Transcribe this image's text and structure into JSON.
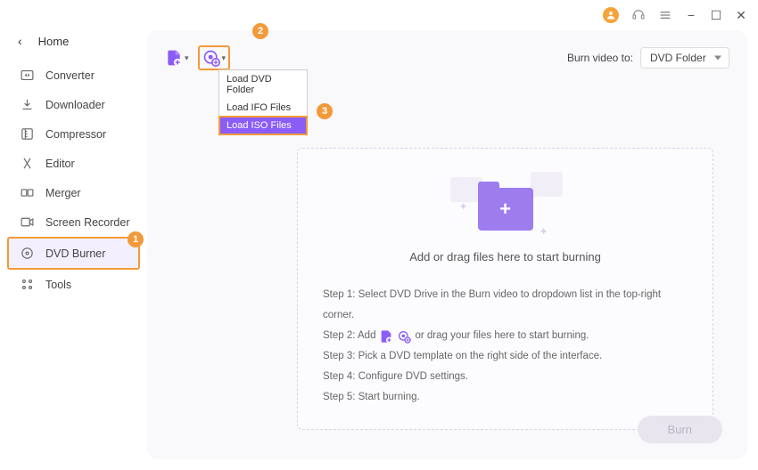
{
  "titlebar": {
    "avatar": "user-avatar",
    "support": "support-icon",
    "menu": "menu-icon",
    "minimize": "−",
    "maximize": "☐",
    "close": "✕"
  },
  "sidebar": {
    "back_label": "Home",
    "items": [
      {
        "icon": "converter-icon",
        "label": "Converter"
      },
      {
        "icon": "downloader-icon",
        "label": "Downloader"
      },
      {
        "icon": "compressor-icon",
        "label": "Compressor"
      },
      {
        "icon": "editor-icon",
        "label": "Editor"
      },
      {
        "icon": "merger-icon",
        "label": "Merger"
      },
      {
        "icon": "recorder-icon",
        "label": "Screen Recorder"
      },
      {
        "icon": "dvdburner-icon",
        "label": "DVD Burner"
      },
      {
        "icon": "tools-icon",
        "label": "Tools"
      }
    ],
    "active_index": 6
  },
  "annotations": {
    "badge1": "1",
    "badge2": "2",
    "badge3": "3"
  },
  "toolbar": {
    "burn_to_label": "Burn video to:",
    "burn_to_value": "DVD Folder"
  },
  "dropdown": {
    "items": [
      {
        "label": "Load DVD Folder"
      },
      {
        "label": "Load IFO Files"
      },
      {
        "label": "Load ISO Files"
      }
    ],
    "highlight_index": 2
  },
  "drop_area": {
    "prompt": "Add or drag files here to start burning"
  },
  "steps": {
    "s1": "Step 1: Select DVD Drive in the Burn video to dropdown list in the top-right corner.",
    "s2_pre": "Step 2: Add",
    "s2_post": "or drag your files here to start burning.",
    "s3": "Step 3: Pick a DVD template on the right side of the interface.",
    "s4": "Step 4: Configure DVD settings.",
    "s5": "Step 5: Start burning."
  },
  "colors": {
    "accent_purple": "#8b5cf6",
    "accent_orange": "#f29a3a",
    "panel_bg": "#f9f8fb"
  },
  "footer": {
    "burn_label": "Burn"
  }
}
